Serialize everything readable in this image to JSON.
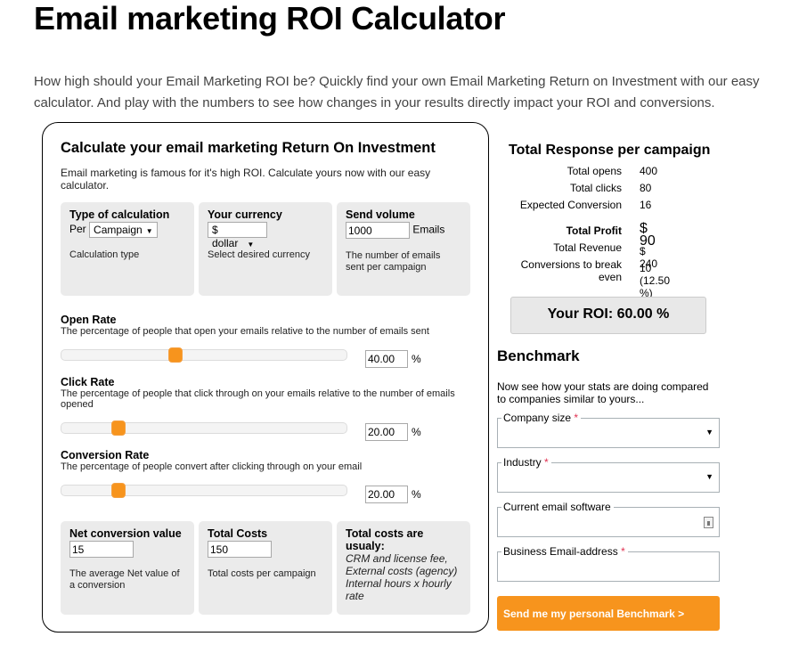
{
  "page": {
    "title": "Email marketing ROI Calculator",
    "intro": "How high should your Email Marketing ROI be? Quickly find your own Email Marketing Return on Investment with our easy calculator. And play with the numbers to see how changes in your results directly impact your ROI and conversions."
  },
  "calculator": {
    "heading": "Calculate your email marketing Return On Investment",
    "description": "Email marketing is famous for it's high ROI. Calculate yours now with our easy calculator.",
    "type_of_calculation": {
      "title": "Type of calculation",
      "prefix": "Per",
      "selected": "Campaign",
      "note": "Calculation type"
    },
    "currency": {
      "title": "Your currency",
      "selected": "$ dollar",
      "note": "Select desired currency"
    },
    "send_volume": {
      "title": "Send volume",
      "value": "1000",
      "unit": "Emails",
      "note": "The number of emails sent per campaign"
    },
    "open_rate": {
      "title": "Open Rate",
      "description": "The percentage of people that open your emails relative to the number of emails sent",
      "value": "40.00",
      "percent": 40,
      "unit": "%"
    },
    "click_rate": {
      "title": "Click Rate",
      "description": "The percentage of people that click through on your emails relative to the number of emails opened",
      "value": "20.00",
      "percent": 20,
      "unit": "%"
    },
    "conversion_rate": {
      "title": "Conversion Rate",
      "description": "The percentage of people convert after clicking through on your email",
      "value": "20.00",
      "percent": 20,
      "unit": "%"
    },
    "net_conversion": {
      "title": "Net conversion value",
      "value": "15",
      "note": "The average Net value of a conversion"
    },
    "total_costs": {
      "title": "Total Costs",
      "value": "150",
      "note": "Total costs per campaign"
    },
    "costs_info": {
      "title": "Total costs are usualy:",
      "lines": [
        "CRM and license fee,",
        "External costs (agency)",
        "Internal hours x hourly rate"
      ]
    }
  },
  "results": {
    "heading": "Total Response per campaign",
    "rows": [
      {
        "label": "Total opens",
        "value": "400"
      },
      {
        "label": "Total clicks",
        "value": "80"
      },
      {
        "label": "Expected Conversion",
        "value": "16"
      }
    ],
    "profit_label": "Total Profit",
    "profit_value": "$ 90",
    "revenue_label": "Total Revenue",
    "revenue_value": "$ 240",
    "breakeven_label": "Conversions to break even",
    "breakeven_value": "10 (12.50 %)",
    "roi": "Your ROI: 60.00 %"
  },
  "benchmark": {
    "heading": "Benchmark",
    "description": "Now see how your stats are doing compared to companies similar to yours...",
    "fields": [
      {
        "label": "Company size",
        "required": true,
        "type": "select"
      },
      {
        "label": "Industry",
        "required": true,
        "type": "select"
      },
      {
        "label": "Current email software",
        "required": false,
        "type": "text"
      },
      {
        "label": "Business Email-address",
        "required": true,
        "type": "text"
      }
    ],
    "required_mark": "*",
    "submit_label": "Send me my personal Benchmark >"
  },
  "colors": {
    "accent": "#f7941d",
    "panel": "#ebebeb"
  }
}
